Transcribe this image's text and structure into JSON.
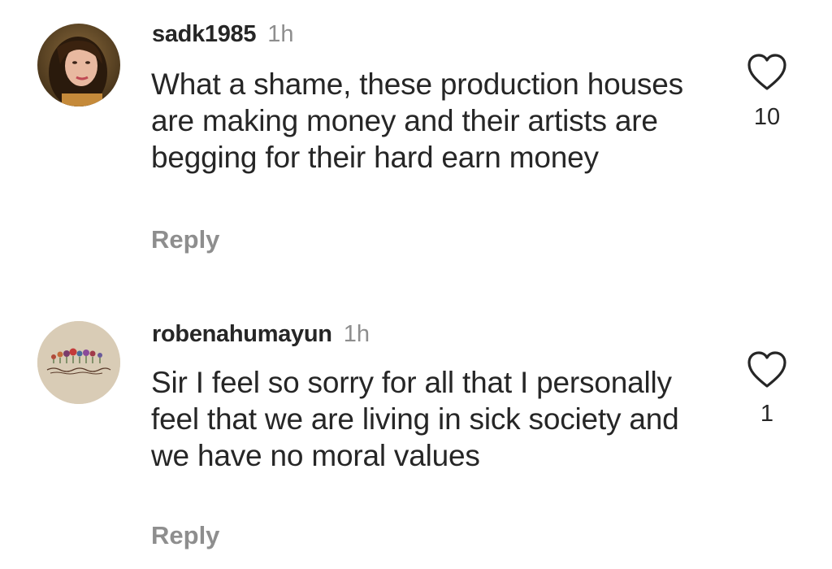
{
  "comments": [
    {
      "username": "sadk1985",
      "time": "1h",
      "text": "What a shame, these production houses are making money and their artists are begging for their hard earn money",
      "likes": "10",
      "reply_label": "Reply",
      "avatar": "profile-photo-woman"
    },
    {
      "username": "robenahumayun",
      "time": "1h",
      "text": "Sir I feel so sorry for all that I personally feel that we are living in sick society and we have no moral values",
      "likes": "1",
      "reply_label": "Reply",
      "avatar": "flowers-calligraphy-logo"
    }
  ],
  "icons": {
    "like": "heart-outline-icon"
  },
  "colors": {
    "text": "#262626",
    "secondary": "#8e8e8e",
    "background": "#ffffff"
  }
}
